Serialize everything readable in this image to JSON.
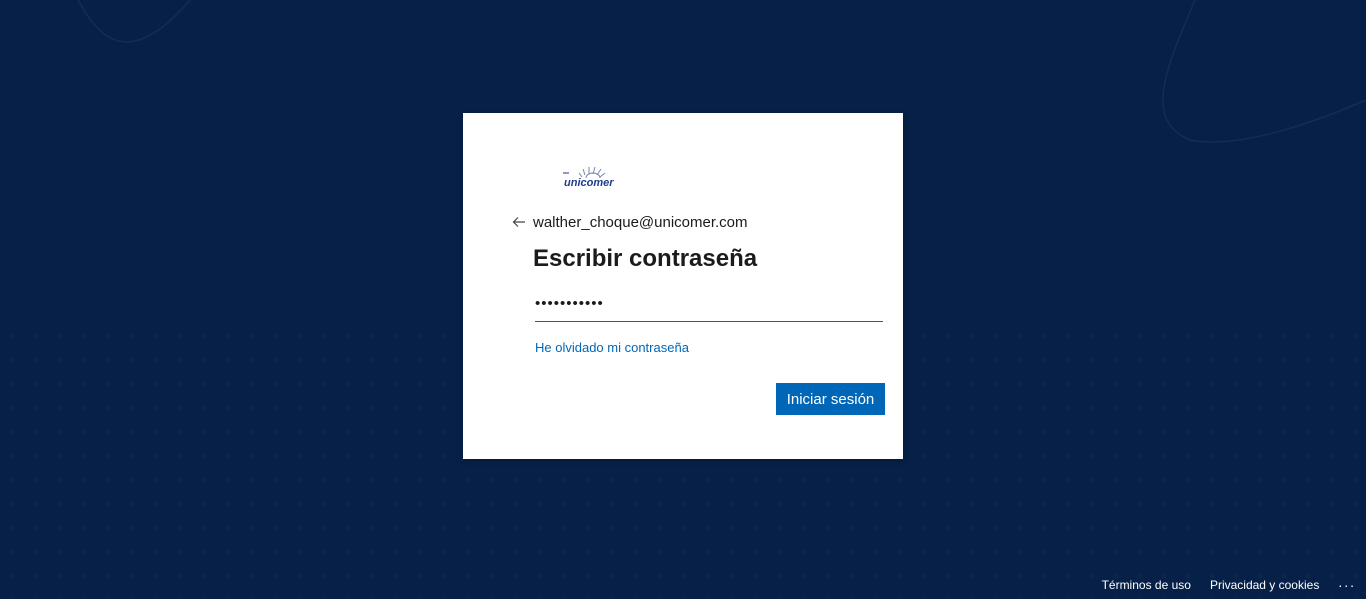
{
  "logo": {
    "text": "unicomer",
    "icon": "unicomer-logo"
  },
  "identity": {
    "back_icon": "arrow-left-icon",
    "email": "walther_choque@unicomer.com"
  },
  "form": {
    "title": "Escribir contraseña",
    "password_value": "•••••••••••",
    "forgot_link": "He olvidado mi contraseña",
    "submit_label": "Iniciar sesión"
  },
  "footer": {
    "terms": "Términos de uso",
    "privacy": "Privacidad y cookies",
    "more": "..."
  },
  "colors": {
    "background": "#062047",
    "accent": "#0067b8",
    "card": "#ffffff"
  }
}
